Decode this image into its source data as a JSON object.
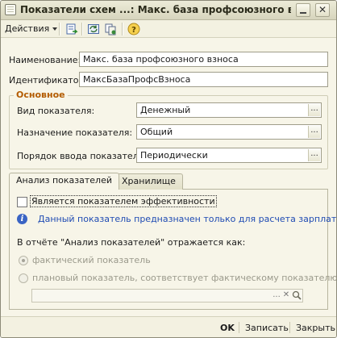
{
  "window": {
    "title": "Показатели схем ...: Макс. база профсоюзного взноса",
    "minimize_glyph": "_",
    "close_glyph": "✕"
  },
  "toolbar": {
    "actions_label": "Действия",
    "help_glyph": "?"
  },
  "fields": {
    "name_label": "Наименование:",
    "name_value": "Макс. база профсоюзного взноса",
    "id_label": "Идентификатор:",
    "id_value": "МаксБазаПрофсВзноса"
  },
  "group": {
    "title": "Основное",
    "type_label": "Вид показателя:",
    "type_value": "Денежный",
    "purpose_label": "Назначение показателя:",
    "purpose_value": "Общий",
    "input_order_label": "Порядок ввода показателя:",
    "input_order_value": "Периодически",
    "ellipsis": "..."
  },
  "tabs": [
    {
      "label": "Анализ показателей",
      "active": true
    },
    {
      "label": "Хранилище",
      "active": false
    }
  ],
  "analysis": {
    "checkbox_label": "Является показателем эффективности",
    "checkbox_checked": false,
    "info_glyph": "i",
    "info_text": "Данный показатель предназначен только для расчета зарплаты",
    "report_text": "В отчёте \"Анализ показателей\" отражается как:",
    "radio_actual": "фактический показатель",
    "radio_planned": "плановый показатель, соответствует фактическому показателю:",
    "planned_value": "",
    "btn_ellipsis": "...",
    "btn_clear": "✕",
    "btn_search": "🔍"
  },
  "bottom": {
    "ok": "OK",
    "save": "Записать",
    "close": "Закрыть"
  },
  "colors": {
    "accent_group_title": "#b35b00",
    "info_text": "#1f4bb3",
    "window_bg": "#f7f5e8"
  }
}
